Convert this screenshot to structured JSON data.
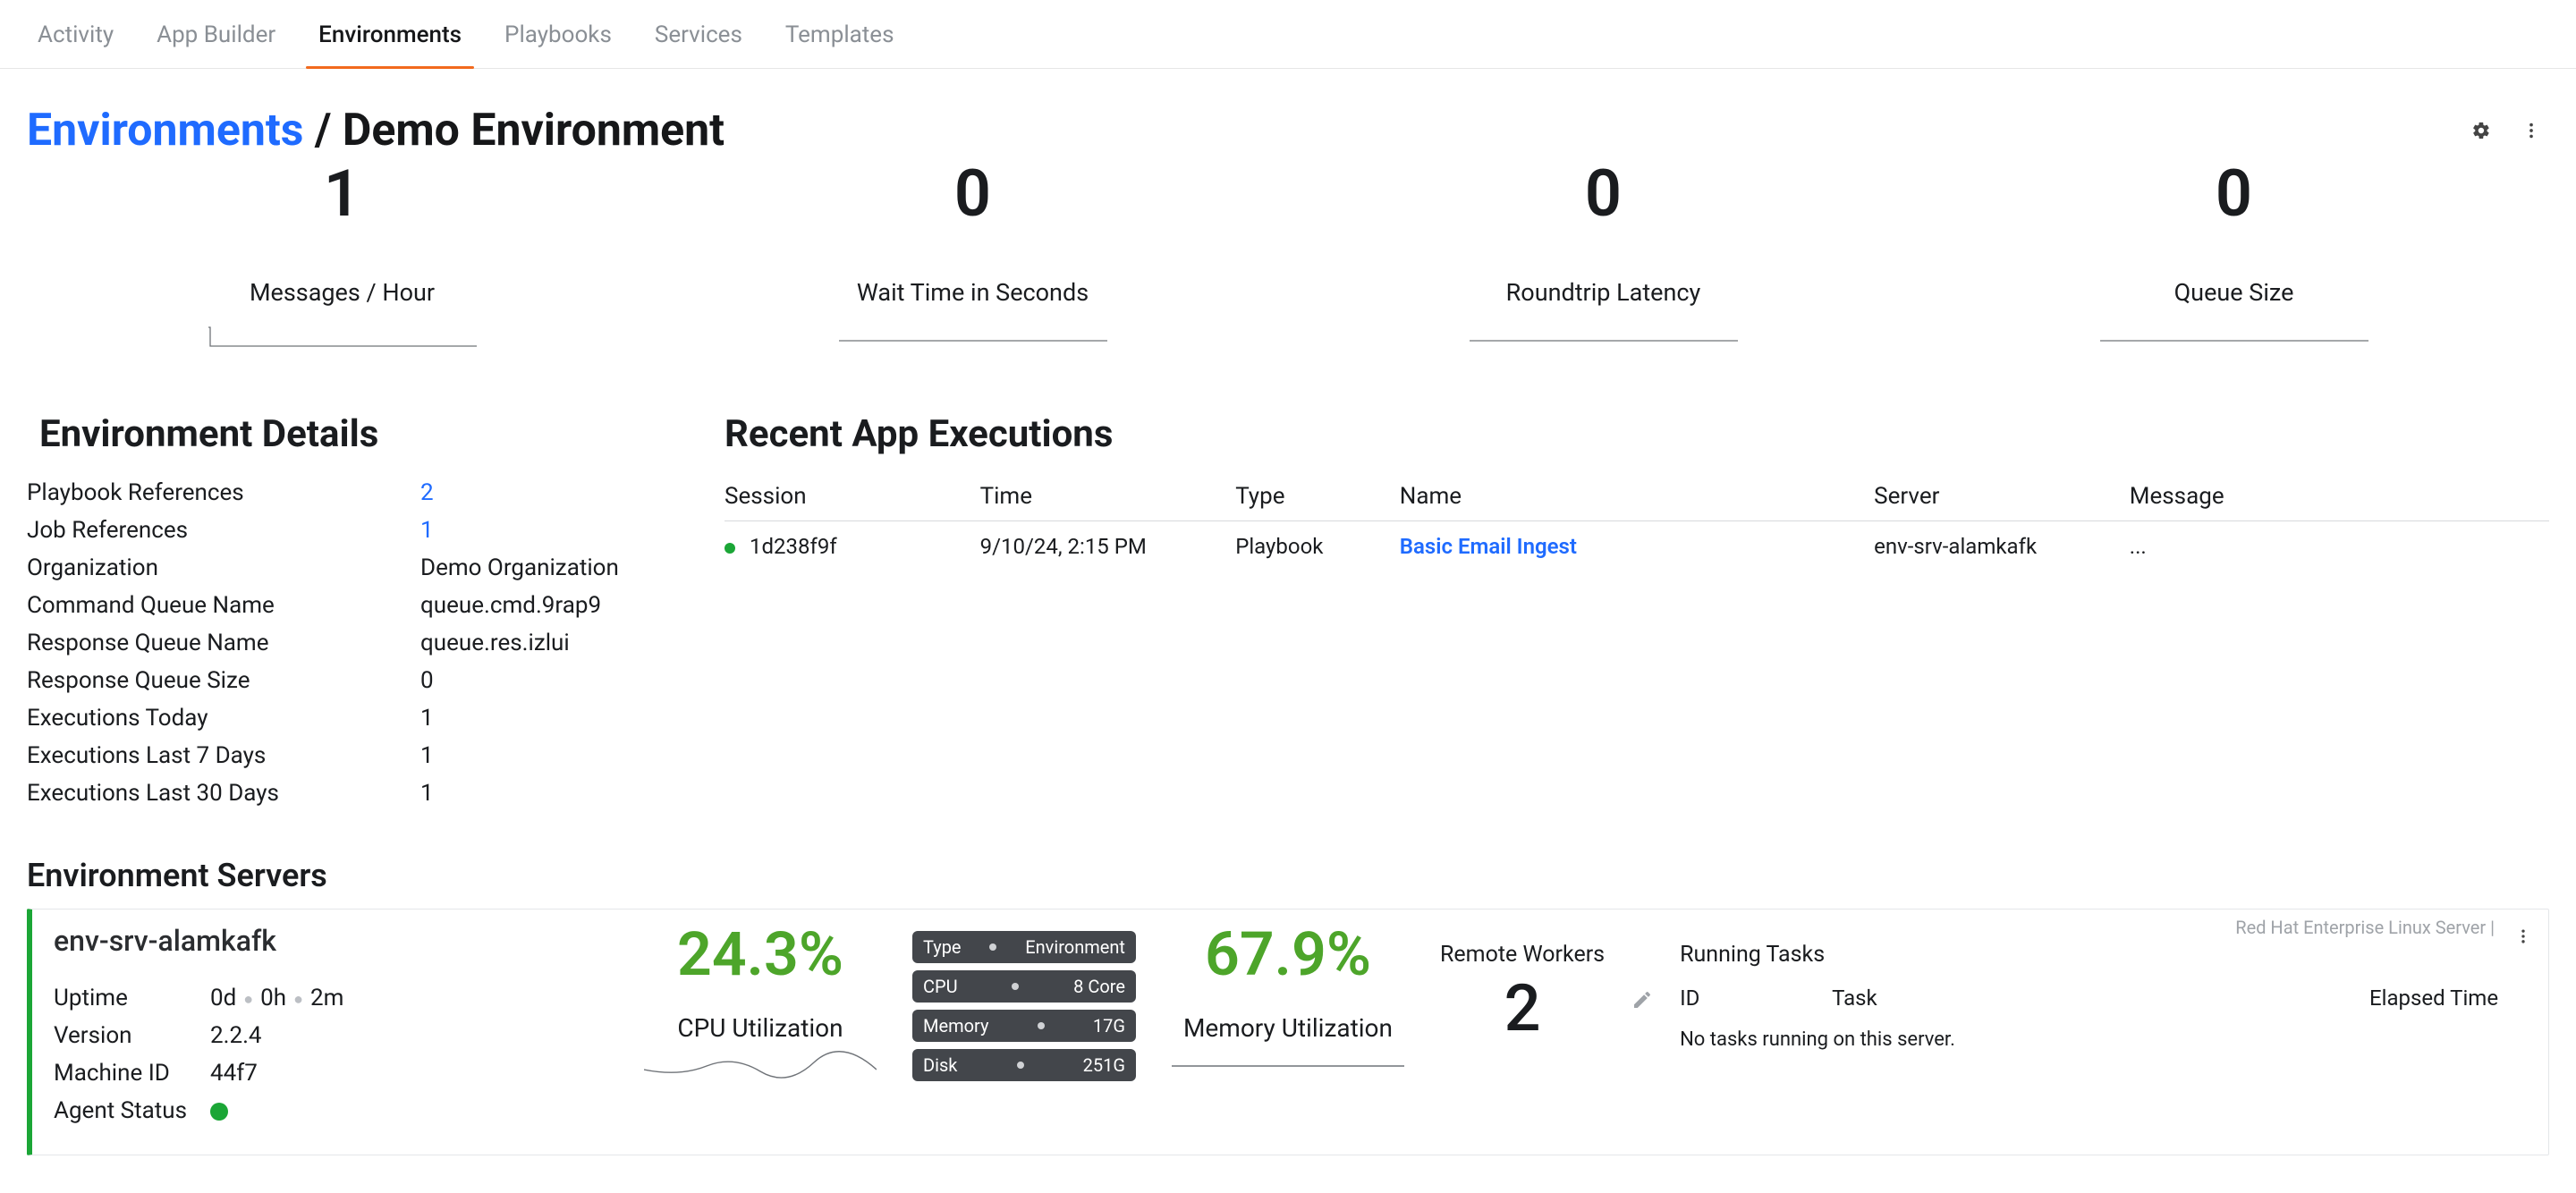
{
  "nav": {
    "tabs": [
      "Activity",
      "App Builder",
      "Environments",
      "Playbooks",
      "Services",
      "Templates"
    ],
    "activeIndex": 2
  },
  "breadcrumb": {
    "root": "Environments",
    "sep": " / ",
    "current": "Demo Environment"
  },
  "metrics": [
    {
      "value": "1",
      "label": "Messages / Hour"
    },
    {
      "value": "0",
      "label": "Wait Time in Seconds"
    },
    {
      "value": "0",
      "label": "Roundtrip Latency"
    },
    {
      "value": "0",
      "label": "Queue Size"
    }
  ],
  "detailsTitle": "Environment Details",
  "details": [
    {
      "key": "Playbook References",
      "val": "2",
      "link": true
    },
    {
      "key": "Job References",
      "val": "1",
      "link": true
    },
    {
      "key": "Organization",
      "val": "Demo Organization"
    },
    {
      "key": "Command Queue Name",
      "val": "queue.cmd.9rap9"
    },
    {
      "key": "Response Queue Name",
      "val": "queue.res.izlui"
    },
    {
      "key": "Response Queue Size",
      "val": "0"
    },
    {
      "key": "Executions Today",
      "val": "1"
    },
    {
      "key": "Executions Last 7 Days",
      "val": "1"
    },
    {
      "key": "Executions Last 30 Days",
      "val": "1"
    }
  ],
  "recent": {
    "title": "Recent App Executions",
    "cols": [
      "Session",
      "Time",
      "Type",
      "Name",
      "Server",
      "Message"
    ],
    "rows": [
      {
        "session": "1d238f9f",
        "time": "9/10/24, 2:15 PM",
        "type": "Playbook",
        "name": "Basic Email Ingest",
        "server": "env-srv-alamkafk",
        "message": "..."
      }
    ]
  },
  "serversTitle": "Environment Servers",
  "server": {
    "name": "env-srv-alamkafk",
    "uptime": {
      "label": "Uptime",
      "d": "0d",
      "h": "0h",
      "m": "2m"
    },
    "version": {
      "label": "Version",
      "val": "2.2.4"
    },
    "machineId": {
      "label": "Machine ID",
      "val": "44f7"
    },
    "agentStatus": {
      "label": "Agent Status"
    },
    "cpu": {
      "value": "24.3%",
      "label": "CPU Utilization"
    },
    "mem": {
      "value": "67.9%",
      "label": "Memory Utilization"
    },
    "pills": [
      {
        "left": "Type",
        "right": "Environment"
      },
      {
        "left": "CPU",
        "right": "8 Core"
      },
      {
        "left": "Memory",
        "right": "17G"
      },
      {
        "left": "Disk",
        "right": "251G"
      }
    ],
    "remoteWorkers": {
      "label": "Remote Workers",
      "value": "2"
    },
    "tasks": {
      "title": "Running Tasks",
      "cols": [
        "ID",
        "Task",
        "Elapsed Time"
      ],
      "empty": "No tasks running on this server."
    },
    "os": "Red Hat Enterprise Linux Server |"
  }
}
